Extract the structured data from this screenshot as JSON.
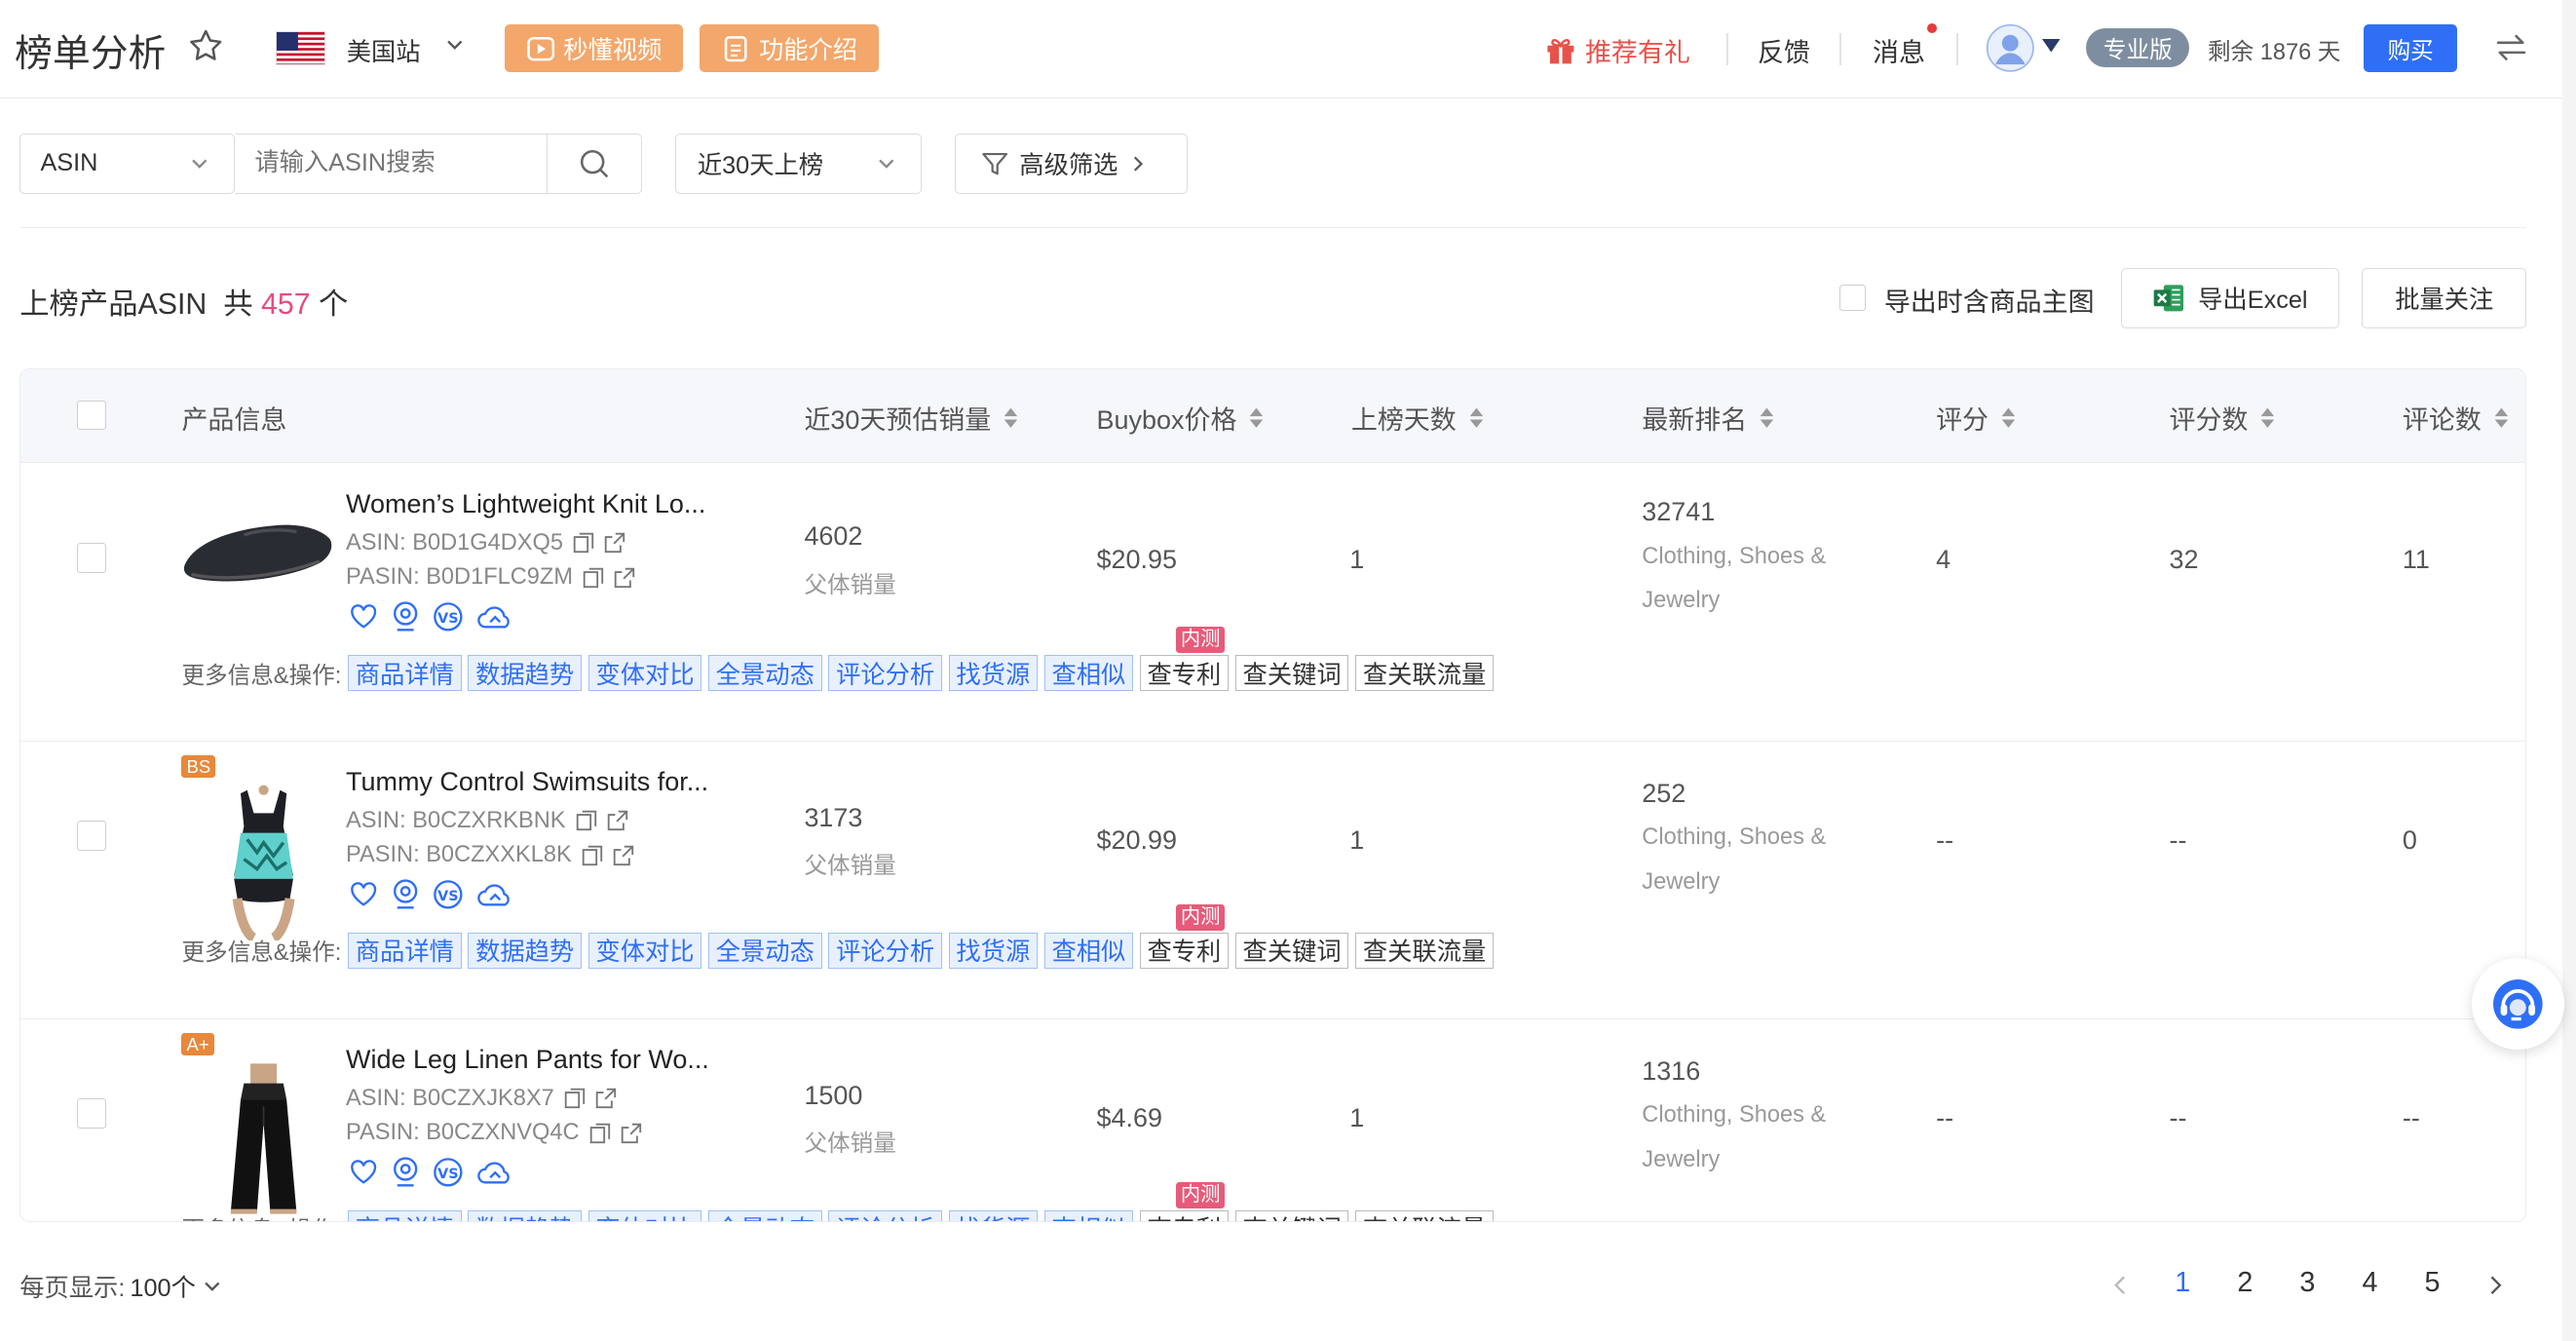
{
  "header": {
    "title": "榜单分析",
    "station": "美国站",
    "video_btn": "秒懂视频",
    "intro_btn": "功能介绍",
    "gift": "推荐有礼",
    "feedback": "反馈",
    "message": "消息",
    "plan": "专业版",
    "remaining": "剩余 1876 天",
    "buy": "购买"
  },
  "filters": {
    "type_select": "ASIN",
    "search_placeholder": "请输入ASIN搜索",
    "period_select": "近30天上榜",
    "advanced": "高级筛选"
  },
  "summary": {
    "prefix": "上榜产品ASIN",
    "gong": "共",
    "count": "457",
    "unit": "个",
    "export_with_image": "导出时含商品主图",
    "export_excel": "导出Excel",
    "batch_follow": "批量关注"
  },
  "table": {
    "columns": [
      "产品信息",
      "近30天预估销量",
      "Buybox价格",
      "上榜天数",
      "最新排名",
      "评分",
      "评分数",
      "评论数"
    ],
    "ops_label": "更多信息&操作:",
    "ops_blue": [
      "商品详情",
      "数据趋势",
      "变体对比",
      "全景动态",
      "评论分析",
      "找货源",
      "查相似"
    ],
    "ops_white": [
      "查专利",
      "查关键词",
      "查关联流量"
    ],
    "inner_test": "内测",
    "sales_sub": "父体销量",
    "rows": [
      {
        "badge": "",
        "name": "Women’s Lightweight Knit Lo...",
        "asin": "ASIN: B0D1G4DXQ5",
        "pasin": "PASIN: B0D1FLC9ZM",
        "sales": "4602",
        "price": "$20.95",
        "days": "1",
        "rank": "32741",
        "category1": "Clothing, Shoes &",
        "category2": "Jewelry",
        "rating": "4",
        "rating_count": "32",
        "reviews": "11"
      },
      {
        "badge": "BS",
        "name": "Tummy Control Swimsuits for...",
        "asin": "ASIN: B0CZXRKBNK",
        "pasin": "PASIN: B0CZXXKL8K",
        "sales": "3173",
        "price": "$20.99",
        "days": "1",
        "rank": "252",
        "category1": "Clothing, Shoes &",
        "category2": "Jewelry",
        "rating": "--",
        "rating_count": "--",
        "reviews": "0"
      },
      {
        "badge": "A+",
        "name": "Wide Leg Linen Pants for Wo...",
        "asin": "ASIN: B0CZXJK8X7",
        "pasin": "PASIN: B0CZXNVQ4C",
        "sales": "1500",
        "price": "$4.69",
        "days": "1",
        "rank": "1316",
        "category1": "Clothing, Shoes &",
        "category2": "Jewelry",
        "rating": "--",
        "rating_count": "--",
        "reviews": "--"
      }
    ]
  },
  "pagination": {
    "per_page_label": "每页显示:",
    "per_page_value": "100个",
    "pages": [
      "1",
      "2",
      "3",
      "4",
      "5"
    ],
    "current": "1"
  },
  "colors": {
    "accent": "#2f6ff5",
    "orange_btn": "#f3a76b",
    "count": "#e64c7c",
    "inner_test": "#e85a7a"
  }
}
